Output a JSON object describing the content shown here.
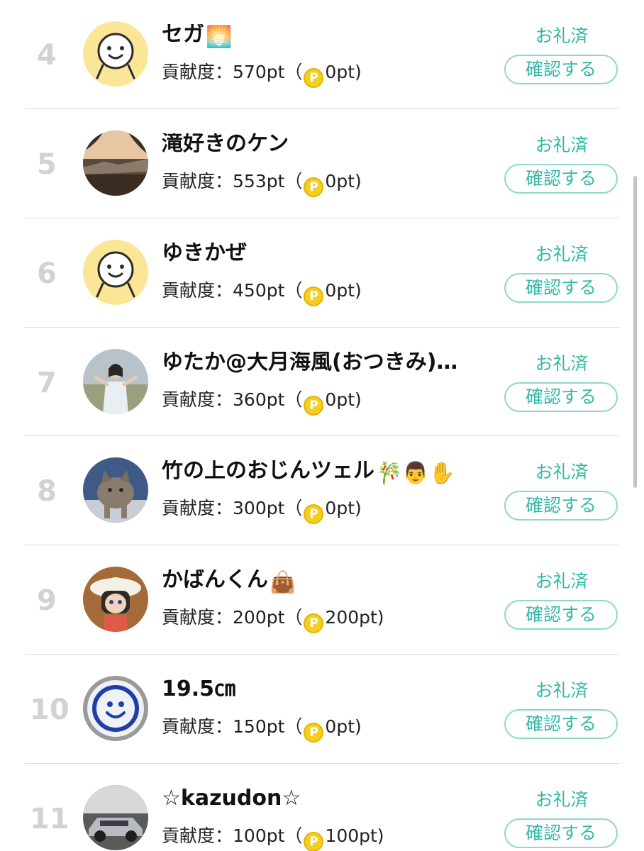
{
  "ranking": {
    "points_label": "貢献度：",
    "thanks_label": "お礼済",
    "confirm_label": "確認する",
    "coin_icon_letter": "P",
    "rows": [
      {
        "rank": "4",
        "name": "セガ",
        "name_emoji": "🌅",
        "points": "570pt",
        "paren_open": "（",
        "bonus": "0pt)",
        "avatar": "smiley-face-yellow"
      },
      {
        "rank": "5",
        "name": "滝好きのケン",
        "name_emoji": "",
        "points": "553pt",
        "paren_open": "（",
        "bonus": "0pt)",
        "avatar": "landscape-photo"
      },
      {
        "rank": "6",
        "name": "ゆきかぜ",
        "name_emoji": "",
        "points": "450pt",
        "paren_open": "（",
        "bonus": "0pt)",
        "avatar": "smiley-face-yellow"
      },
      {
        "rank": "7",
        "name": "ゆたか@大月海風(おつきみ)…",
        "name_emoji": "",
        "points": "360pt",
        "paren_open": "（",
        "bonus": "0pt)",
        "avatar": "person-photo"
      },
      {
        "rank": "8",
        "name": "竹の上のおじんツェル",
        "name_emoji": "🎋👨✋",
        "points": "300pt",
        "paren_open": "（",
        "bonus": "0pt)",
        "avatar": "cat-photo"
      },
      {
        "rank": "9",
        "name": "かばんくん",
        "name_emoji": "👜",
        "points": "200pt",
        "paren_open": "（",
        "bonus": "200pt)",
        "avatar": "anime-character"
      },
      {
        "rank": "10",
        "name": "19.5㎝",
        "name_emoji": "",
        "points": "150pt",
        "paren_open": "（",
        "bonus": "0pt)",
        "avatar": "smiley-cup"
      },
      {
        "rank": "11",
        "name": "☆kazudon☆",
        "name_emoji": "",
        "points": "100pt",
        "paren_open": "（",
        "bonus": "100pt)",
        "avatar": "car-photo"
      }
    ]
  },
  "colors": {
    "accent": "#31b8a8",
    "button_border": "#8fd7cf",
    "rank_gray": "#d2d2d2",
    "coin_gold": "#f5cf1f",
    "avatar_default_yellow": "#fbe597"
  }
}
